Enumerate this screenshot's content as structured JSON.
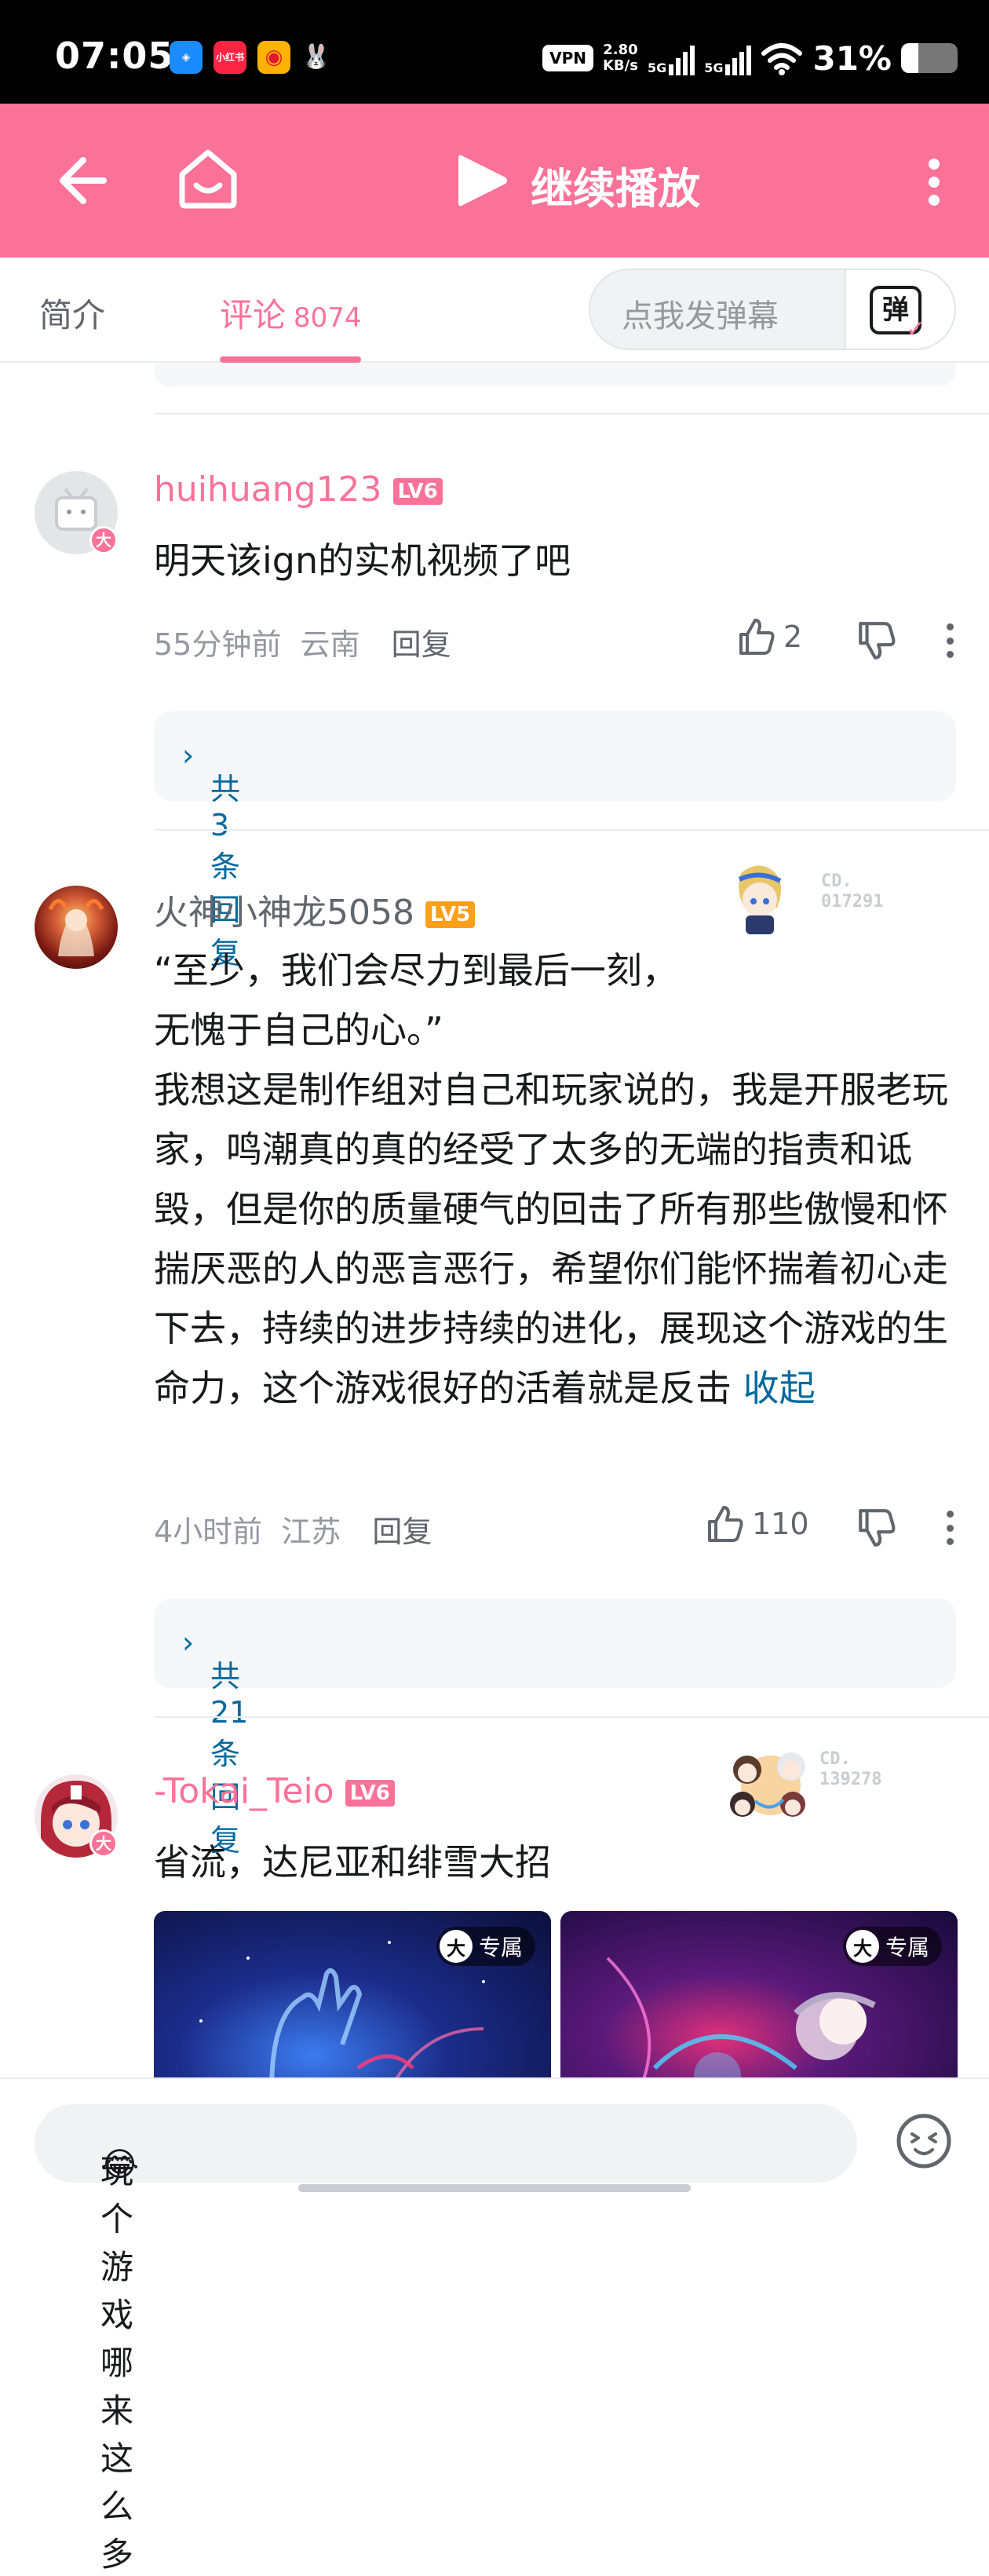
{
  "status": {
    "time": "07:05",
    "vpn": "VPN",
    "speed": "2.80",
    "speed_unit": "KB/s",
    "net1": "5G",
    "net2": "5G",
    "battery": "31%",
    "battery_level": 0.31
  },
  "header": {
    "play_label": "继续播放"
  },
  "tabs": {
    "intro": "简介",
    "comments": "评论",
    "comment_count": "8074",
    "danmaku_placeholder": "点我发弹幕",
    "danmaku_icon": "弹"
  },
  "comments": [
    {
      "user": "huihuang123",
      "level": "LV6",
      "text": "明天该ign的实机视频了吧",
      "time": "55分钟前",
      "location": "云南",
      "reply_label": "回复",
      "likes": "2",
      "replies": "共3条回复",
      "big_badge": "大"
    },
    {
      "user": "火神小神龙5058",
      "level": "LV5",
      "garb_no": "CD.\n017291",
      "text": "“至少，我们会尽力到最后一刻，\n无愧于自己的心。”\n我想这是制作组对自己和玩家说的，我是开服老玩家，鸣潮真的真的经受了太多的无端的指责和诋毁，但是你的质量硬气的回击了所有那些傲慢和怀揣厌恶的人的恶言恶行，希望你们能怀揣着初心走下去，持续的进步持续的进化，展现这个游戏的生命力，这个游戏很好的活着就是反击",
      "collapse": "收起",
      "time": "4小时前",
      "location": "江苏",
      "reply_label": "回复",
      "likes": "110",
      "replies": "共21条回复"
    },
    {
      "user": "-Tokai_Teio",
      "level": "LV6",
      "garb_no": "CD.\n139278",
      "text": "省流，达尼亚和绯雪大招",
      "big_badge": "大",
      "image_tag": "专属",
      "image_tag_icon": "大"
    }
  ],
  "footer": {
    "input_text": "玩个游戏哪来这么多",
    "input_emoji": "😂"
  },
  "colors": {
    "brand": "#fb7299",
    "link": "#00699d",
    "lv6": "#fb7299",
    "lv5": "#ff9f1a"
  }
}
